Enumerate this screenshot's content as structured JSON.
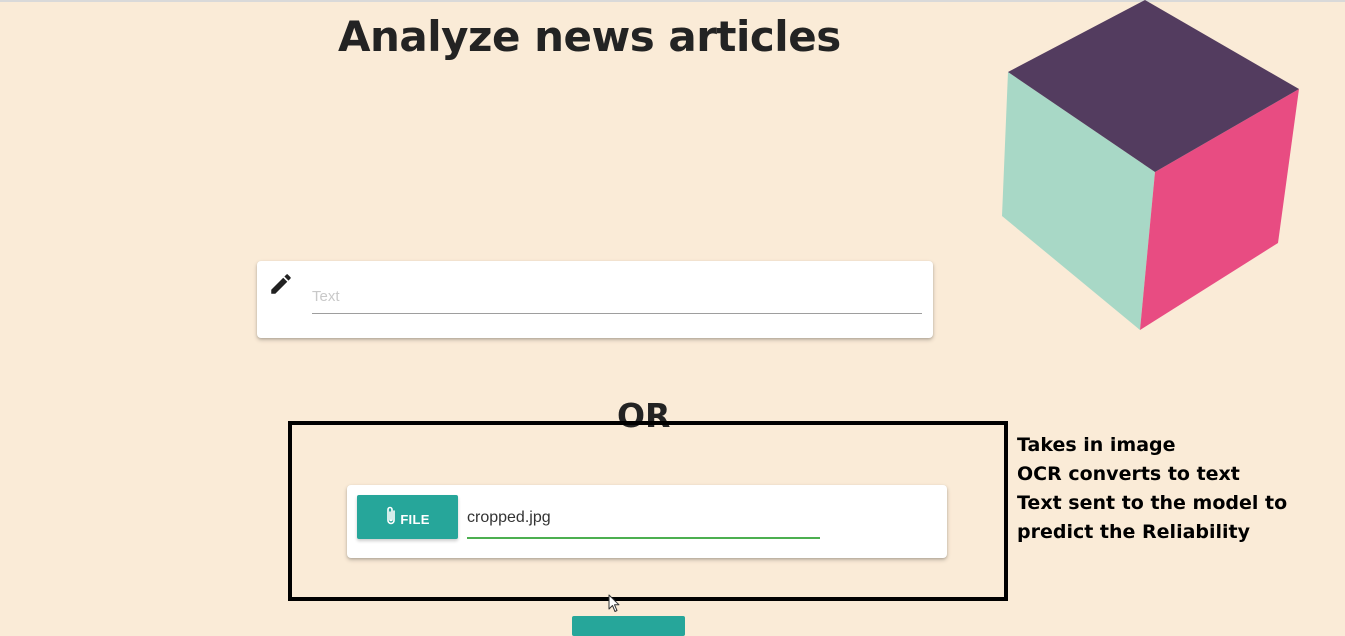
{
  "page": {
    "title": "Analyze news articles",
    "or_label": "OR"
  },
  "text_input": {
    "placeholder": "Text",
    "value": "",
    "icon": "pencil-icon"
  },
  "file_upload": {
    "button_label": "FILE",
    "button_icon": "paperclip-icon",
    "selected_file": "cropped.jpg"
  },
  "annotation": {
    "lines": [
      "Takes in image",
      "OCR converts to text",
      "Text sent to the model to",
      "predict the Reliability"
    ]
  },
  "colors": {
    "background": "#faebd7",
    "accent": "#26a69a",
    "input_focus": "#4caf50",
    "cube_top": "#533c5f",
    "cube_left": "#a8d8c6",
    "cube_right": "#e84c82"
  }
}
